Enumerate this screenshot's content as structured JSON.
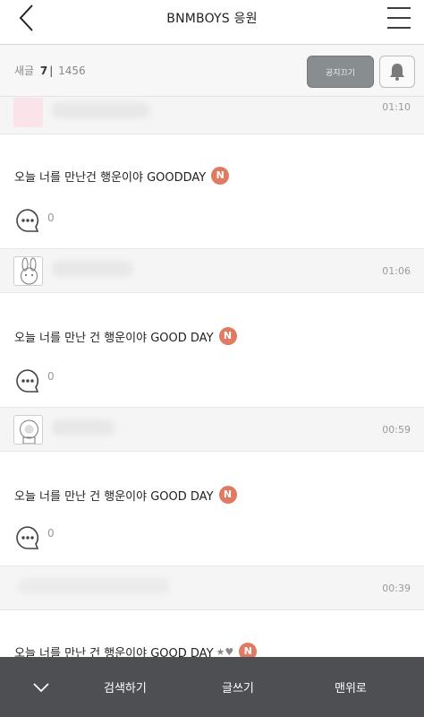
{
  "header": {
    "title": "BNMBOYS 응원",
    "back_icon": "chevron-left-icon",
    "menu_icon": "hamburger-menu-icon"
  },
  "subbar": {
    "new_label": "새글",
    "new_count": "7",
    "separator": "|",
    "total_count": "1456",
    "notice_button": "공지끄기",
    "bell_icon": "bell-icon"
  },
  "posts": [
    {
      "time": "01:10"
    },
    {
      "title": "오늘 너를 만난건 행운이야 GOODDAY",
      "badge": "N",
      "comments": "0",
      "time": "01:06"
    },
    {
      "title": "오늘 너를 만난 건 행운이야 GOOD DAY",
      "badge": "N",
      "comments": "0",
      "time": "00:59"
    },
    {
      "title": "오늘 너를 만난 건 행운이야 GOOD DAY",
      "badge": "N",
      "comments": "0",
      "time": "00:39"
    },
    {
      "title": "오늘 너를 만난 건 행운이야 GOOD DAY",
      "badge": "N"
    }
  ],
  "footer": {
    "collapse_icon": "chevron-down-icon",
    "search": "검색하기",
    "write": "글쓰기",
    "top": "맨위로"
  },
  "colors": {
    "badge": "#e07b63",
    "footer_bg": "#4e4f52",
    "notice_bg": "#888d90"
  }
}
